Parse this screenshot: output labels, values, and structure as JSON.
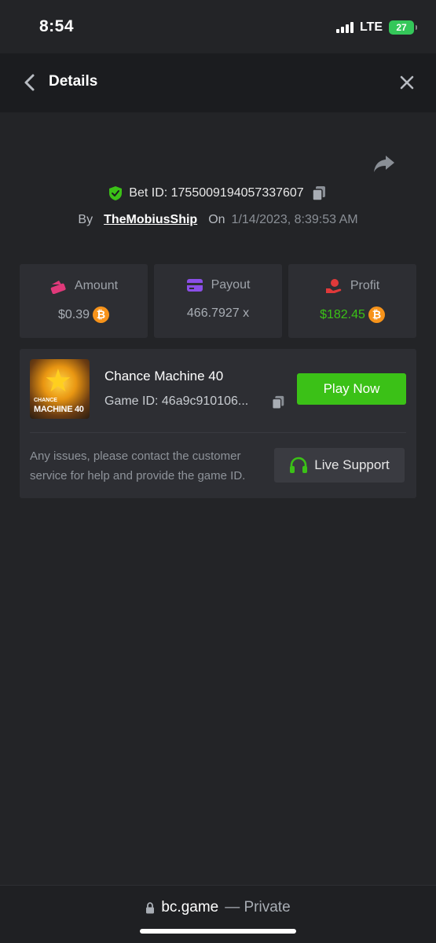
{
  "status_bar": {
    "time": "8:54",
    "network": "LTE",
    "battery": "27"
  },
  "header": {
    "title": "Details",
    "back_icon": "chevron-left-icon",
    "close_icon": "close-icon"
  },
  "bet": {
    "id_label": "Bet ID: 1755009194057337607",
    "by_label": "By",
    "username": "TheMobiusShip",
    "on_label": "On",
    "timestamp": "1/14/2023, 8:39:53 AM"
  },
  "stats": [
    {
      "label": "Amount",
      "value": "$0.39",
      "icon": "amount-icon",
      "has_coin": true,
      "color": "#a8adb4"
    },
    {
      "label": "Payout",
      "value": "466.7927 x",
      "icon": "card-icon",
      "has_coin": false,
      "color": "#a8adb4"
    },
    {
      "label": "Profit",
      "value": "$182.45",
      "icon": "profit-icon",
      "has_coin": true,
      "color": "#3bc117"
    }
  ],
  "game": {
    "title": "Chance Machine 40",
    "game_id": "Game ID: 46a9c910106...",
    "thumb_line1": "CHANCE",
    "thumb_line2": "MACHINE 40",
    "play_label": "Play Now",
    "help_text": "Any issues, please contact the customer service for help and provide the game ID.",
    "support_label": "Live Support"
  },
  "browser": {
    "domain": "bc.game",
    "mode": "— Private"
  },
  "colors": {
    "accent_green": "#3bc117",
    "bitcoin": "#f7931a",
    "background": "#232427",
    "card": "#2d2e33"
  }
}
